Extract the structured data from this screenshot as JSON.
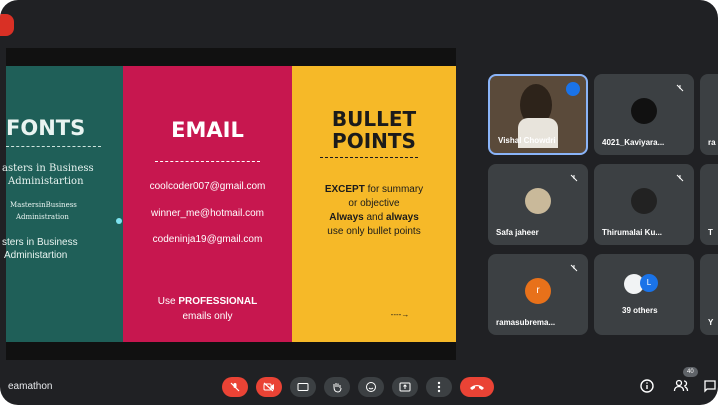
{
  "slide": {
    "fonts_title": "FONTS",
    "fonts_lines": [
      "asters in Business",
      "Administartion",
      "MastersinBusiness",
      "Administration",
      "sters in Business",
      "Administartion"
    ],
    "email_title": "EMAIL",
    "emails": [
      "coolcoder007@gmail.com",
      "winner_me@hotmail.com",
      "codeninja19@gmail.com"
    ],
    "email_note_prefix": "Use ",
    "email_note_bold": "PROFESSIONAL",
    "email_note_2": "emails only",
    "bullet_title_1": "BULLET",
    "bullet_title_2": "POINTS",
    "bullet_l1_bold": "EXCEPT",
    "bullet_l1_rest": " for summary",
    "bullet_l2": "or objective",
    "bullet_l3_a": "Always",
    "bullet_l3_b": " and ",
    "bullet_l3_c": "always",
    "bullet_l4": "use only bullet points",
    "arrow": "----→"
  },
  "participants": [
    {
      "name": "Vishal Chowdri",
      "speaking": true
    },
    {
      "name": "4021_Kaviyara...",
      "muted": true
    },
    {
      "name": "ra"
    },
    {
      "name": "Safa jaheer",
      "muted": true
    },
    {
      "name": "Thirumalai Ku...",
      "muted": true
    },
    {
      "name": "T"
    },
    {
      "name": "ramasubrema...",
      "muted": true,
      "initial": "r"
    },
    {
      "name": "39 others",
      "initial": "L"
    },
    {
      "name": "Y"
    }
  ],
  "bottom": {
    "meeting_name": "eamathon",
    "participant_count": "40"
  },
  "colors": {
    "teal": "#1f5f58",
    "crimson": "#c7174f",
    "amber": "#f6b928",
    "end_call": "#ea4335"
  }
}
